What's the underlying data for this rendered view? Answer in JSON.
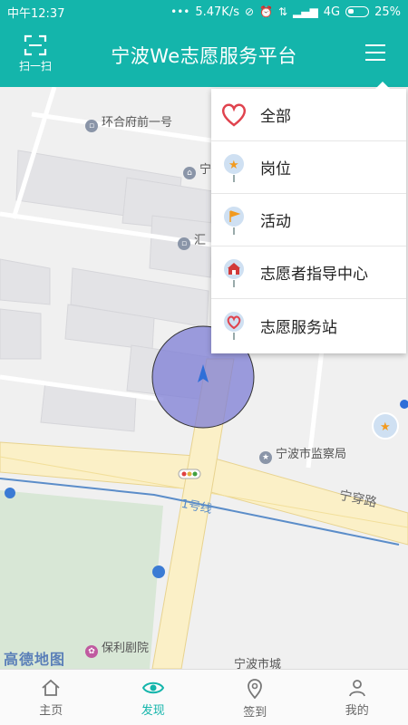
{
  "status_bar": {
    "time": "中午12:37",
    "net_speed": "5.47K/s",
    "network": "4G",
    "battery": "25%"
  },
  "header": {
    "scan_label": "扫一扫",
    "title": "宁波We志愿服务平台"
  },
  "map": {
    "labels": {
      "poi_1": "环合府前一号",
      "poi_2": "宁",
      "poi_3": "汇",
      "poi_4": "宁波市监察局",
      "poi_5": "保利剧院",
      "poi_6": "宁波市城",
      "road_1": "宁穿路",
      "road_2": "1号线"
    },
    "provider": "高德地图"
  },
  "dropdown": {
    "items": [
      {
        "label": "全部",
        "icon": "heart-outline-icon"
      },
      {
        "label": "岗位",
        "icon": "star-pin-icon"
      },
      {
        "label": "活动",
        "icon": "flag-pin-icon"
      },
      {
        "label": "志愿者指导中心",
        "icon": "building-pin-icon"
      },
      {
        "label": "志愿服务站",
        "icon": "heart-pin-icon"
      }
    ]
  },
  "bottom_nav": {
    "items": [
      {
        "label": "主页",
        "icon": "home-icon",
        "active": false
      },
      {
        "label": "发现",
        "icon": "eye-icon",
        "active": true
      },
      {
        "label": "签到",
        "icon": "location-icon",
        "active": false
      },
      {
        "label": "我的",
        "icon": "user-icon",
        "active": false
      }
    ]
  },
  "colors": {
    "primary": "#14b5ab",
    "heart": "#e0434e",
    "location_circle": "#7d7dd6"
  }
}
